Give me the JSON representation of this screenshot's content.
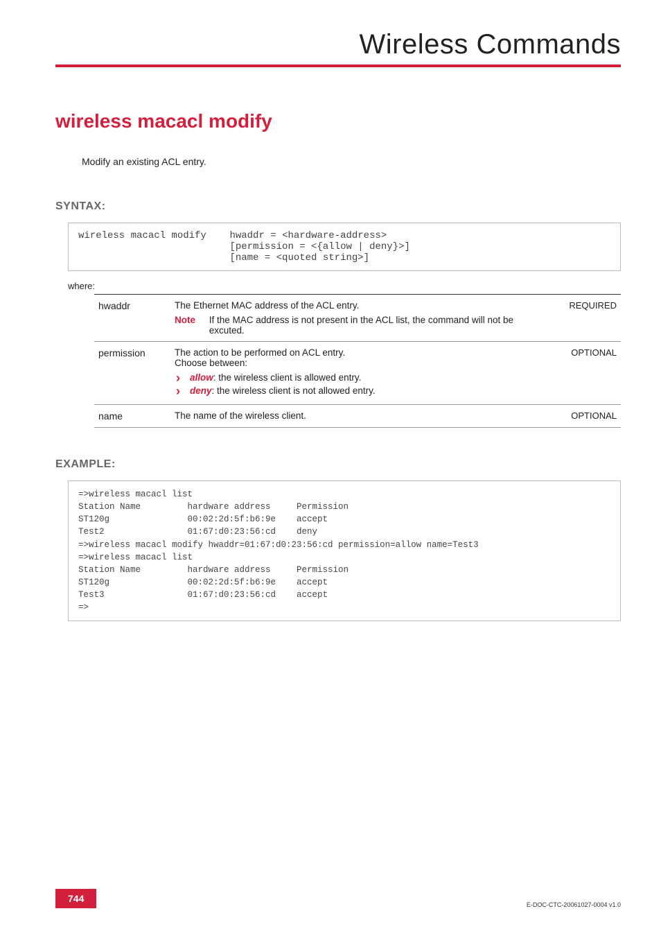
{
  "header": {
    "category": "Wireless Commands"
  },
  "title": "wireless macacl modify",
  "intro": "Modify an existing ACL entry.",
  "syntax": {
    "heading": "SYNTAX:",
    "command": "wireless macacl modify",
    "arg1": "hwaddr = <hardware-address>",
    "arg2": "[permission = <{allow | deny}>]",
    "arg3": "[name = <quoted string>]",
    "where": "where:"
  },
  "params": {
    "hwaddr": {
      "name": "hwaddr",
      "desc": "The Ethernet MAC address of the ACL entry.",
      "note_label": "Note",
      "note_text": "If the MAC address is not present in the ACL list, the command will not be excuted.",
      "req": "REQUIRED"
    },
    "permission": {
      "name": "permission",
      "desc_line1": "The action to be performed on ACL entry.",
      "desc_line2": "Choose between:",
      "opt_allow_key": "allow",
      "opt_allow_rest": ": the wireless client is allowed entry.",
      "opt_deny_key": "deny",
      "opt_deny_rest": ": the wireless client is not allowed entry.",
      "req": "OPTIONAL"
    },
    "name": {
      "name": "name",
      "desc": "The name of the wireless client.",
      "req": "OPTIONAL"
    }
  },
  "example": {
    "heading": "EXAMPLE:",
    "lines": [
      "=>wireless macacl list",
      "Station Name         hardware address     Permission",
      "ST120g               00:02:2d:5f:b6:9e    accept",
      "Test2                01:67:d0:23:56:cd    deny",
      "=>wireless macacl modify hwaddr=01:67:d0:23:56:cd permission=allow name=Test3",
      "=>wireless macacl list",
      "Station Name         hardware address     Permission",
      "ST120g               00:02:2d:5f:b6:9e    accept",
      "Test3                01:67:d0:23:56:cd    accept",
      "=>"
    ]
  },
  "footer": {
    "page": "744",
    "docid": "E-DOC-CTC-20061027-0004 v1.0"
  }
}
